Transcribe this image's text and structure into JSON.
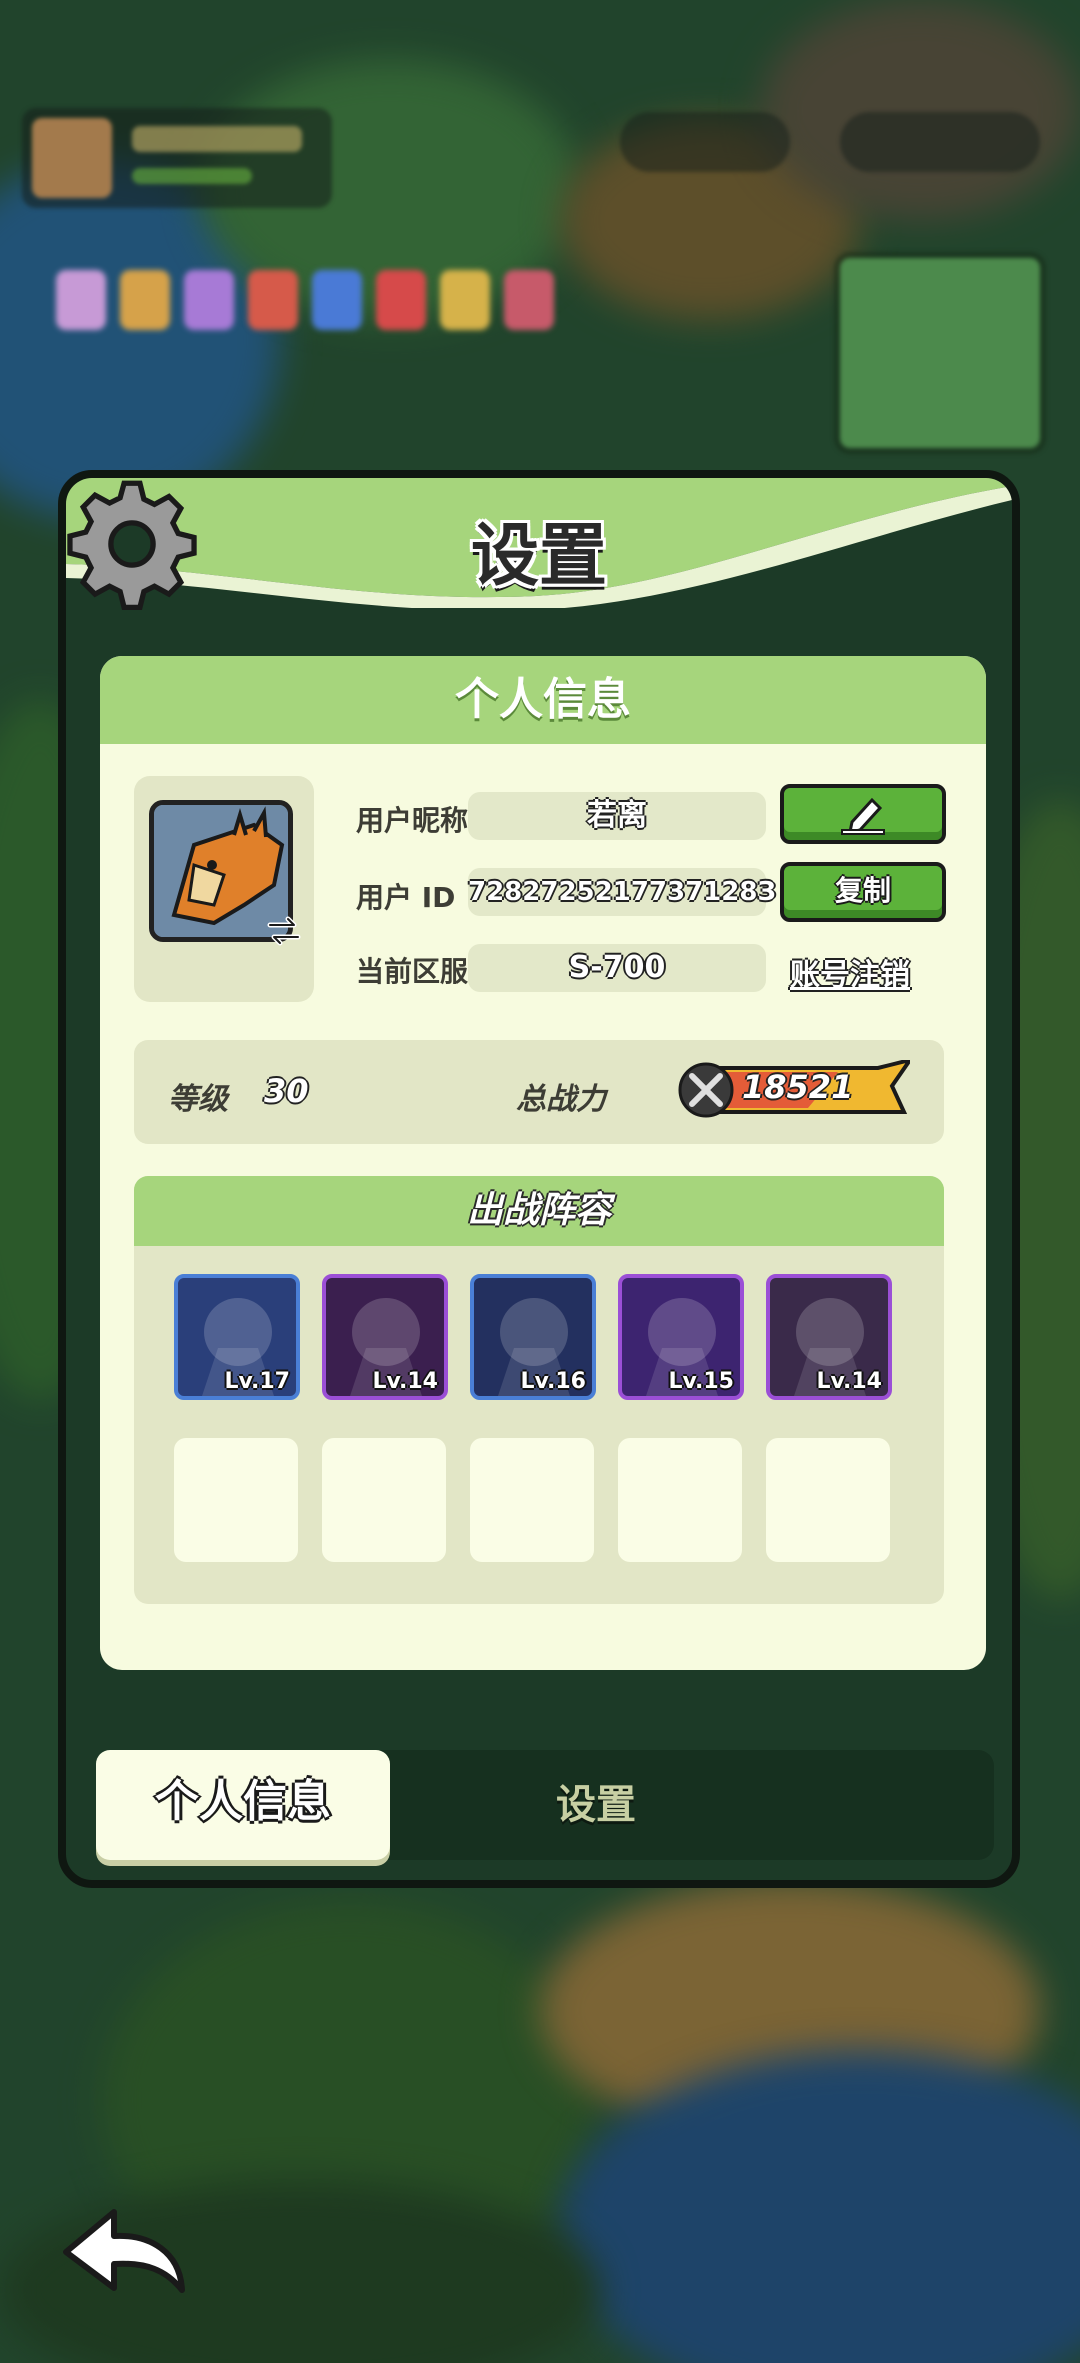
{
  "dialog": {
    "title": "设置",
    "panel_title": "个人信息"
  },
  "profile": {
    "nickname_label": "用户昵称",
    "nickname": "若离",
    "id_label": "用户 ID",
    "user_id": "7282725217737128З",
    "server_label": "当前区服",
    "server": "S-700",
    "copy_label": "复制",
    "logout_label": "账号注销"
  },
  "stats": {
    "level_label": "等级",
    "level": "30",
    "power_label": "总战力",
    "power": "18521"
  },
  "lineup": {
    "title": "出战阵容",
    "heroes": [
      {
        "level": "Lv.17",
        "frame": "#4a7fd6",
        "bg": "#2a3f7a"
      },
      {
        "level": "Lv.14",
        "frame": "#9b4fd6",
        "bg": "#3b1f4f"
      },
      {
        "level": "Lv.16",
        "frame": "#4a7fd6",
        "bg": "#23305f"
      },
      {
        "level": "Lv.15",
        "frame": "#9b4fd6",
        "bg": "#3d2470"
      },
      {
        "level": "Lv.14",
        "frame": "#9b4fd6",
        "bg": "#3a2a4a"
      }
    ]
  },
  "tabs": {
    "active": "个人信息",
    "inactive": "设置"
  },
  "icons": {
    "gear": "gear-icon",
    "edit": "pencil-icon",
    "swap": "swap-icon",
    "power": "crossed-swords-icon",
    "back": "back-arrow-icon"
  },
  "colors": {
    "panel_bg": "#f7fbdf",
    "header_green": "#a6d57c",
    "button_green": "#5cb23a",
    "dialog_bg": "#1c3a27"
  }
}
